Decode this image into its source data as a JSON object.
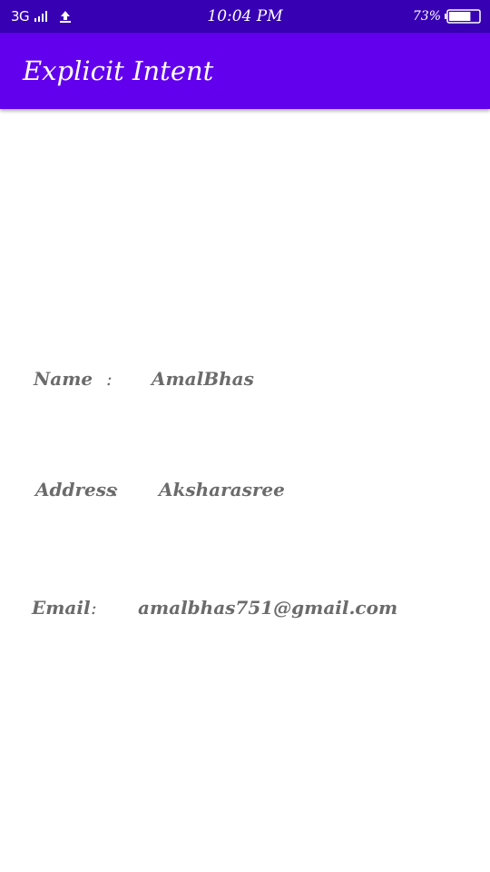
{
  "status_bar": {
    "network": "3G",
    "time": "10:04 PM",
    "battery_percent": "73%",
    "battery_level": 0.73,
    "icons": [
      "signal-icon",
      "upload-icon",
      "battery-icon"
    ]
  },
  "app_bar": {
    "title": "Explicit Intent",
    "color": "#6200ee",
    "status_color": "#3700b3"
  },
  "details": {
    "name_label": "Name",
    "name_sep": ":",
    "name_value": "AmalBhas",
    "address_label": "Address",
    "address_sep": ":",
    "address_value": "Aksharasree",
    "email_label": "Email",
    "email_sep": ":",
    "email_value": "amalbhas751@gmail.com"
  }
}
